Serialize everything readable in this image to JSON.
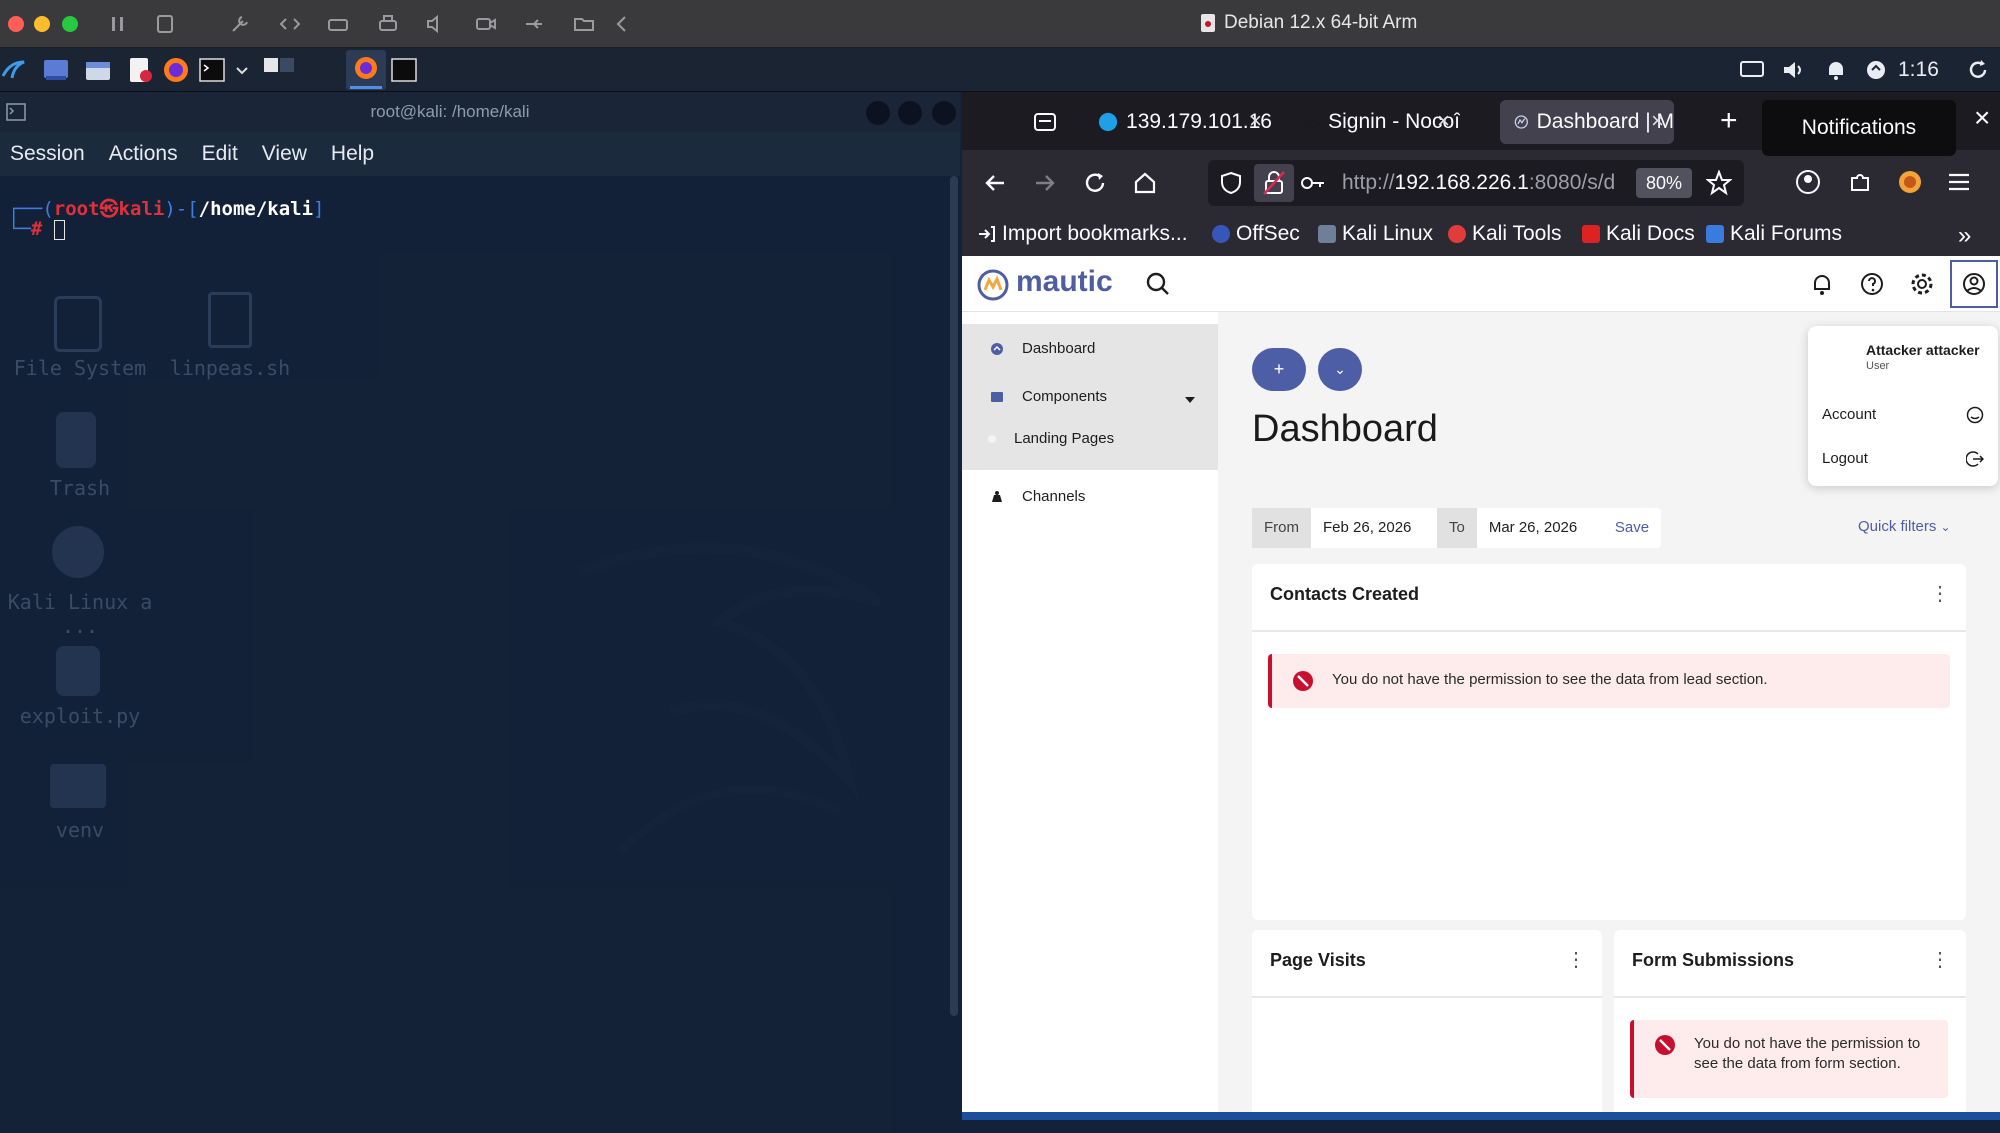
{
  "vm": {
    "title": "Debian 12.x 64-bit Arm",
    "traffic_colors": [
      "#ff5f57",
      "#febc2e",
      "#28c840"
    ]
  },
  "panel": {
    "time": "1:16",
    "icons": [
      "kali-menu-icon",
      "workspace-icon",
      "file-manager-icon",
      "text-editor-icon",
      "firefox-icon",
      "terminal-icon",
      "display-icon",
      "volume-icon",
      "notification-bell-icon",
      "power-icon",
      "refresh-icon"
    ]
  },
  "terminal": {
    "title": "root@kali: /home/kali",
    "menu": [
      "Session",
      "Actions",
      "Edit",
      "View",
      "Help"
    ],
    "prompt_user": "root",
    "prompt_at": "㉿",
    "prompt_host": "kali",
    "prompt_path": "/home/kali",
    "prompt_symbol": "#"
  },
  "desktop": {
    "icons": [
      "File System",
      "linpeas.sh",
      "Trash",
      "Kali Linux a ...",
      "exploit.py",
      "venv"
    ]
  },
  "browser": {
    "tabs": [
      {
        "label": "139.179.101.16"
      },
      {
        "label": "Signin - Nocoî"
      },
      {
        "label": "Dashboard | M"
      }
    ],
    "new_tab": "+",
    "notifications_tooltip": "Notifications",
    "url_prefix": "http://",
    "url_host": "192.168.226.1",
    "url_rest": ":8080/s/d",
    "zoom": "80%",
    "bookmarks": [
      "Import bookmarks...",
      "OffSec",
      "Kali Linux",
      "Kali Tools",
      "Kali Docs",
      "Kali Forums"
    ],
    "accent": "#4e5ea6"
  },
  "mautic": {
    "logo": "mautic",
    "user_name": "Attacker attacker",
    "user_role": "User",
    "user_menu": [
      "Account",
      "Logout"
    ],
    "sidebar": {
      "dashboard": "Dashboard",
      "components": "Components",
      "landing_pages": "Landing Pages",
      "channels": "Channels"
    },
    "page_title": "Dashboard",
    "filters": {
      "from_label": "From",
      "from_value": "Feb 26, 2026",
      "to_label": "To",
      "to_value": "Mar 26, 2026",
      "save": "Save",
      "quick_filters": "Quick filters"
    },
    "widgets": {
      "contacts_title": "Contacts Created",
      "contacts_error": "You do not have the permission to see the data from lead section.",
      "page_visits_title": "Page Visits",
      "form_title": "Form Submissions",
      "form_error": "You do not have the permission to see the data from form section."
    },
    "error_color": "#c8102e"
  }
}
